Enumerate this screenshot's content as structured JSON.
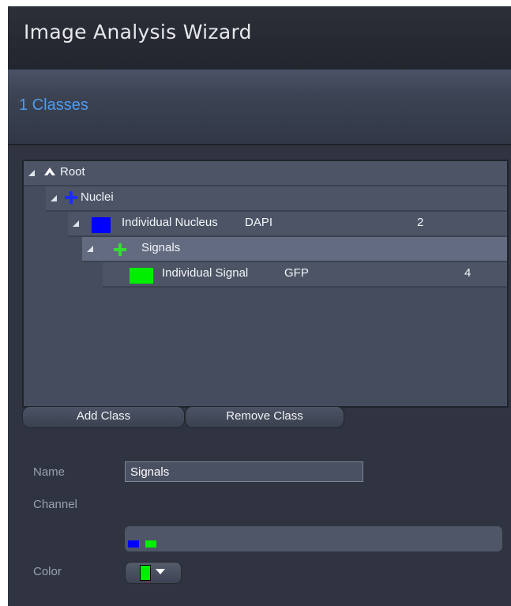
{
  "window": {
    "title": "Image Analysis Wizard"
  },
  "step": {
    "label": "1  Classes"
  },
  "tree": {
    "rows": [
      {
        "label": "Root"
      },
      {
        "label": "Nuclei"
      },
      {
        "label": "Individual Nucleus",
        "channel": "DAPI",
        "count": "2",
        "color": "#0000ff"
      },
      {
        "label": "Signals"
      },
      {
        "label": "Individual Signal",
        "channel": "GFP",
        "count": "4",
        "color": "#00ee00"
      }
    ]
  },
  "buttons": {
    "add_class": "Add Class",
    "remove_class": "Remove Class"
  },
  "form": {
    "name_label": "Name",
    "name_value": "Signals",
    "channel_label": "Channel",
    "color_label": "Color",
    "channel_colors": [
      "#0000ff",
      "#00ee00"
    ],
    "selected_color": "#00ee00"
  },
  "colors": {
    "accent": "#4e9cf0",
    "nuclei_blue": "#0000ff",
    "signal_green": "#00ee00"
  }
}
